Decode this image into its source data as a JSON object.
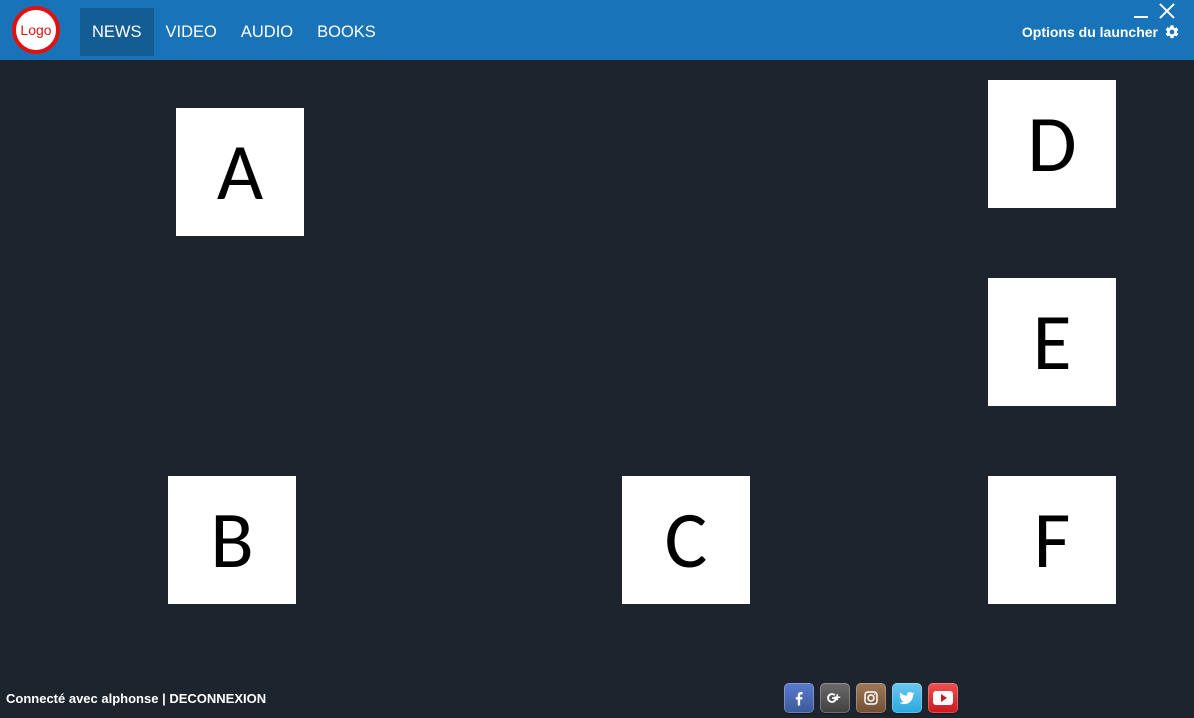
{
  "header": {
    "logo_text": "Logo",
    "tabs": [
      {
        "label": "NEWS",
        "active": true
      },
      {
        "label": "VIDEO",
        "active": false
      },
      {
        "label": "AUDIO",
        "active": false
      },
      {
        "label": "BOOKS",
        "active": false
      }
    ],
    "options_label": "Options du launcher"
  },
  "tiles": {
    "A": "A",
    "B": "B",
    "C": "C",
    "D": "D",
    "E": "E",
    "F": "F"
  },
  "footer": {
    "connected_prefix": "Connecté avec ",
    "username": "alphonse",
    "separator": " | ",
    "logout": "DECONNEXION"
  },
  "social": [
    "facebook",
    "google-plus",
    "instagram",
    "twitter",
    "youtube"
  ]
}
